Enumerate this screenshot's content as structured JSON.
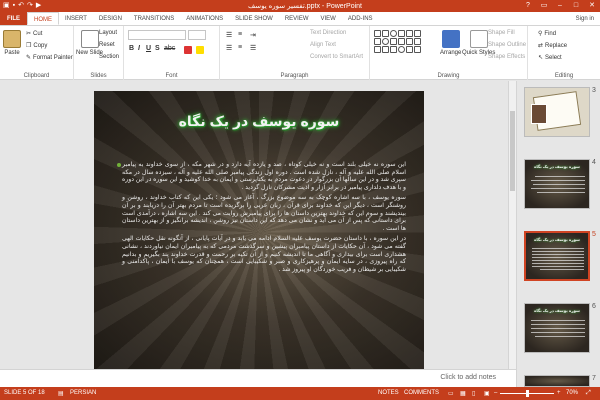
{
  "titlebar": {
    "title": "تفسیر سوره یوسف.pptx - PowerPoint",
    "qat": [
      "save-icon",
      "undo-icon",
      "redo-icon",
      "present-icon"
    ],
    "window_controls": {
      "help": "?",
      "restore": "▭",
      "minimize": "–",
      "maximize": "□",
      "close": "✕"
    }
  },
  "tabs": [
    "FILE",
    "HOME",
    "INSERT",
    "DESIGN",
    "TRANSITIONS",
    "ANIMATIONS",
    "SLIDE SHOW",
    "REVIEW",
    "VIEW",
    "ADD-INS"
  ],
  "active_tab": "HOME",
  "signin": "Sign in",
  "ribbon": {
    "clipboard": {
      "label": "Clipboard",
      "paste": "Paste",
      "cut": "Cut",
      "copy": "Copy",
      "format_painter": "Format Painter"
    },
    "slides": {
      "label": "Slides",
      "new_slide": "New Slide",
      "layout": "Layout",
      "reset": "Reset",
      "section": "Section"
    },
    "font": {
      "label": "Font",
      "bold": "B",
      "italic": "I",
      "underline": "U",
      "shadow": "S",
      "strike": "abc"
    },
    "paragraph": {
      "label": "Paragraph",
      "text_direction": "Text Direction",
      "align_text": "Align Text",
      "convert_smartart": "Convert to SmartArt"
    },
    "drawing": {
      "label": "Drawing",
      "arrange": "Arrange",
      "quick_styles": "Quick Styles",
      "shape_fill": "Shape Fill",
      "shape_outline": "Shape Outline",
      "shape_effects": "Shape Effects"
    },
    "editing": {
      "label": "Editing",
      "find": "Find",
      "replace": "Replace",
      "select": "Select"
    }
  },
  "slide": {
    "title": "سوره یوسف در یک نگاه",
    "paragraphs": [
      "این سوره نه خیلی بلند است و نه خیلی کوتاه ، صد و یازده آیه دارد و در شهر مکه ، از سوی خداوند به پیامبر اسلام صلی الله علیه و آله ، نازل شده است . دوره اول زندگی پیامبر صلی الله علیه و آله ، سیزده سال در مکه سپری شد و در این سالها آن بزرگوار در دعوت مردم به یکتاپرستی و ایمان به خدا کوشید و این سوره در این دوره و با هدف دلداری پیامبر در برابر آزار و اذیت مشرکان نازل گردید .",
      "سوره یوسف ، با سه اشاره کوچک به سه موضوع بزرگ ، آغاز می شود ؛ یکی این که کتاب خداوند ، روشن و روشنگر است ، دیگر این که خداوند برای قرآن ، زبان عربی را برگزیده است تا مردم بهتر آن را دریابند و بر آن بیندیشند و سوم این که خداوند بهترین داستان ها را برای پیامبرش روایت می کند . این سه اشاره ، درآمدی است برای داستانی که پس از آن می آید و نشان می دهد که این داستان نیز روشن ، اندیشه برانگیز و از بهترین داستان ها است .",
      "در این سوره ، با داستان حضرت یوسف علیه السلام ادامه می یابد و در آیات پایانی ، از آنگونه نقل حکایات الهی گفته می شود ، آن حکایات از داستان پیامبران پیشین و سرگذشت مردمی که به پیامبران ایمان نیاوردند ، نشانی هشداری است برای بیداری و آگاهی ما تا اندیشه کنیم و از آن تکیه بر رحمت و قدرت خداوند پند بگیریم و بدانیم که راه پیروزی ، در سایه ایمان و پرهیزکاری و صبر و شکیبایی است ، همچنان که یوسف با ایمان ، پاکدامنی و شکیبایی بر شیطان و فریب خوردگان او پیروز شد ."
    ]
  },
  "notes_placeholder": "Click to add notes",
  "thumbnails": [
    {
      "num": "3",
      "title": ""
    },
    {
      "num": "4",
      "title": "سوره یوسف در یک نگاه"
    },
    {
      "num": "5",
      "title": "سوره یوسف در یک نگاه",
      "selected": true
    },
    {
      "num": "6",
      "title": "سوره یوسف در یک نگاه"
    },
    {
      "num": "7",
      "title": ""
    }
  ],
  "status": {
    "slide_info": "SLIDE 5 OF 18",
    "language": "PERSIAN",
    "notes": "NOTES",
    "comments": "COMMENTS",
    "zoom": "70%",
    "accent": "#c43e1c"
  }
}
